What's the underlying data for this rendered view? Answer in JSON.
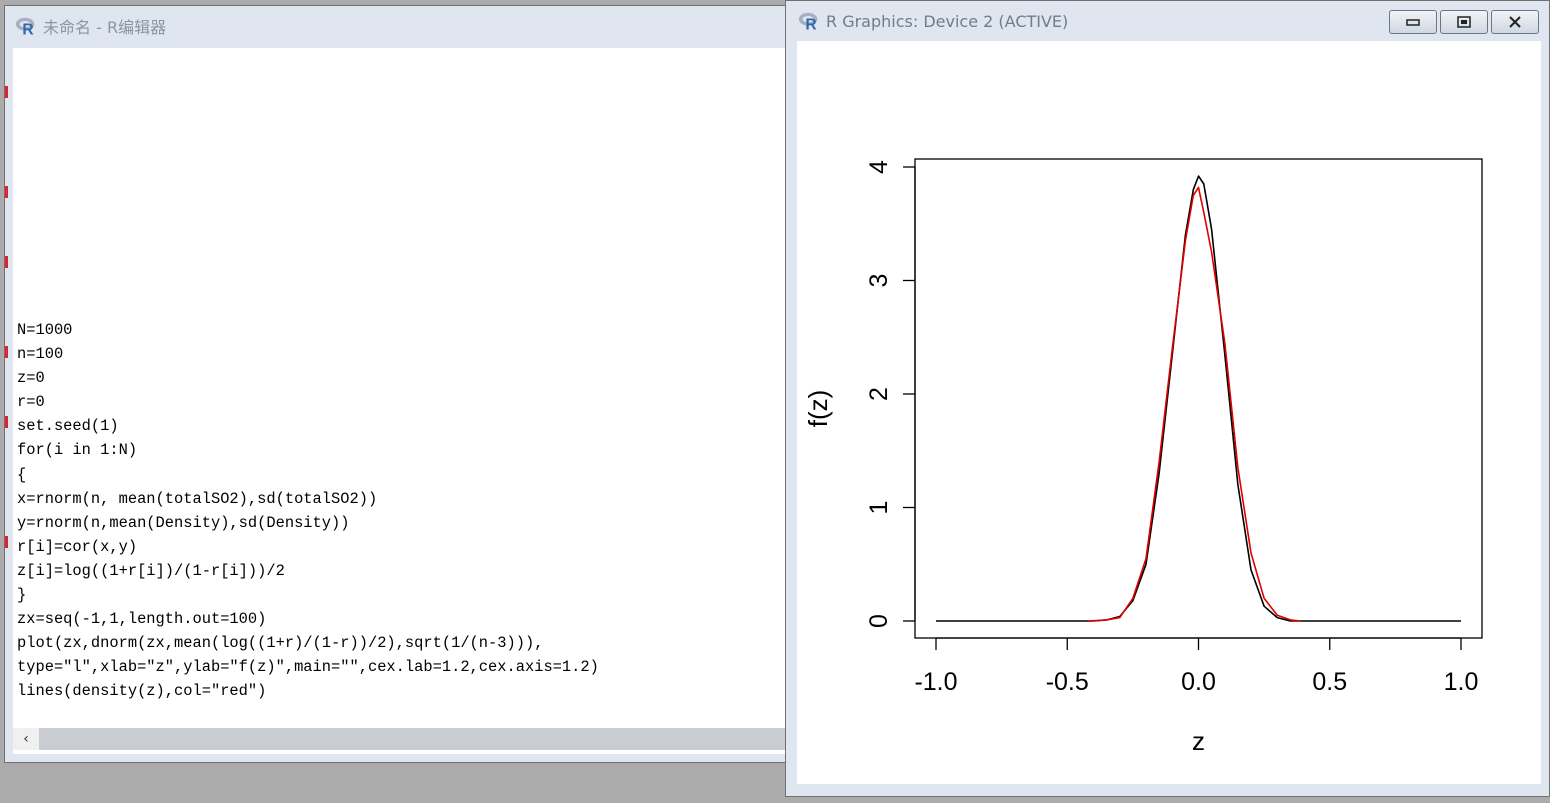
{
  "editor": {
    "title": "未命名 - R编辑器",
    "code_lines": [
      "N=1000",
      "n=100",
      "z=0",
      "r=0",
      "set.seed(1)",
      "for(i in 1:N)",
      "{",
      "x=rnorm(n, mean(totalSO2),sd(totalSO2))",
      "y=rnorm(n,mean(Density),sd(Density))",
      "r[i]=cor(x,y)",
      "z[i]=log((1+r[i])/(1-r[i]))/2",
      "}",
      "zx=seq(-1,1,length.out=100)",
      "plot(zx,dnorm(zx,mean(log((1+r)/(1-r))/2),sqrt(1/(n-3))),",
      "type=\"l\",xlab=\"z\",ylab=\"f(z)\",main=\"\",cex.lab=1.2,cex.axis=1.2)",
      "lines(density(z),col=\"red\")"
    ],
    "scroll_left_glyph": "‹"
  },
  "graphics": {
    "title": "R Graphics: Device 2 (ACTIVE)",
    "buttons": [
      "minimize",
      "maximize",
      "close"
    ]
  },
  "icons": {
    "r_logo": "r-logo-icon",
    "minimize": "minimize-icon",
    "maximize": "maximize-icon",
    "close": "close-icon"
  },
  "colors": {
    "series_normal": "#000000",
    "series_density": "#e00000"
  },
  "chart_data": {
    "type": "line",
    "title": "",
    "xlabel": "z",
    "ylabel": "f(z)",
    "xlim": [
      -1.0,
      1.0
    ],
    "ylim": [
      0,
      4
    ],
    "xticks": [
      "-1.0",
      "-0.5",
      "0.0",
      "0.5",
      "1.0"
    ],
    "yticks": [
      "0",
      "1",
      "2",
      "3",
      "4"
    ],
    "grid": false,
    "series": [
      {
        "color": "#000000",
        "x": [
          -1.0,
          -0.6,
          -0.4,
          -0.35,
          -0.3,
          -0.25,
          -0.2,
          -0.15,
          -0.1,
          -0.05,
          -0.02,
          0.0,
          0.02,
          0.05,
          0.1,
          0.15,
          0.2,
          0.25,
          0.3,
          0.35,
          0.4,
          0.6,
          1.0
        ],
        "y": [
          0.0,
          0.0,
          0.0,
          0.01,
          0.04,
          0.18,
          0.5,
          1.3,
          2.35,
          3.4,
          3.8,
          3.92,
          3.85,
          3.45,
          2.35,
          1.2,
          0.45,
          0.13,
          0.03,
          0.0,
          0.0,
          0.0,
          0.0
        ]
      },
      {
        "color": "#e00000",
        "x": [
          -0.42,
          -0.35,
          -0.3,
          -0.25,
          -0.2,
          -0.15,
          -0.1,
          -0.05,
          -0.02,
          0.0,
          0.02,
          0.05,
          0.1,
          0.15,
          0.2,
          0.25,
          0.3,
          0.35,
          0.39
        ],
        "y": [
          0.0,
          0.01,
          0.03,
          0.2,
          0.55,
          1.4,
          2.4,
          3.35,
          3.75,
          3.82,
          3.6,
          3.25,
          2.45,
          1.35,
          0.6,
          0.2,
          0.05,
          0.01,
          0.0
        ]
      }
    ]
  }
}
